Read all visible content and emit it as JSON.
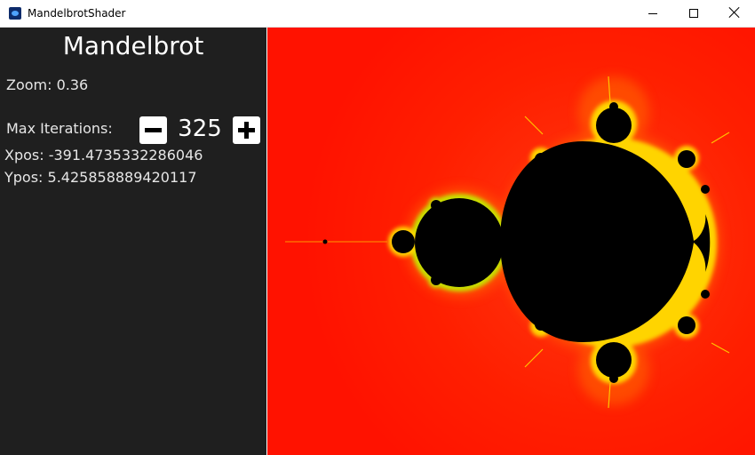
{
  "window": {
    "title": "MandelbrotShader",
    "icon": "app-icon"
  },
  "panel": {
    "heading": "Mandelbrot",
    "zoom_text": "Zoom: 0.36",
    "max_iterations_label": "Max Iterations:",
    "max_iterations_value": "325",
    "decrease_icon": "minus-icon",
    "increase_icon": "plus-icon",
    "xpos_text": "Xpos: -391.4735332286046",
    "ypos_text": "Ypos: 5.425858889420117"
  },
  "colors": {
    "panel_bg": "#1f1f1f",
    "fractal_bg": "#ff1a00",
    "fractal_set": "#000000",
    "fractal_edge": "#ffd400"
  }
}
